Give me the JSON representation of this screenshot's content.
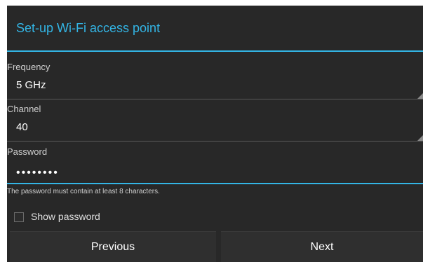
{
  "dialog": {
    "title": "Set-up Wi-Fi access point",
    "frequency": {
      "label": "Frequency",
      "value": "5 GHz"
    },
    "channel": {
      "label": "Channel",
      "value": "40"
    },
    "password": {
      "label": "Password",
      "masked_value": "••••••••",
      "hint": "The password must contain at least 8 characters."
    },
    "show_password": {
      "label": "Show password",
      "checked": false
    },
    "buttons": {
      "previous": "Previous",
      "next": "Next"
    }
  },
  "colors": {
    "accent": "#33b5e5",
    "background": "#282828",
    "text": "#ffffff"
  }
}
